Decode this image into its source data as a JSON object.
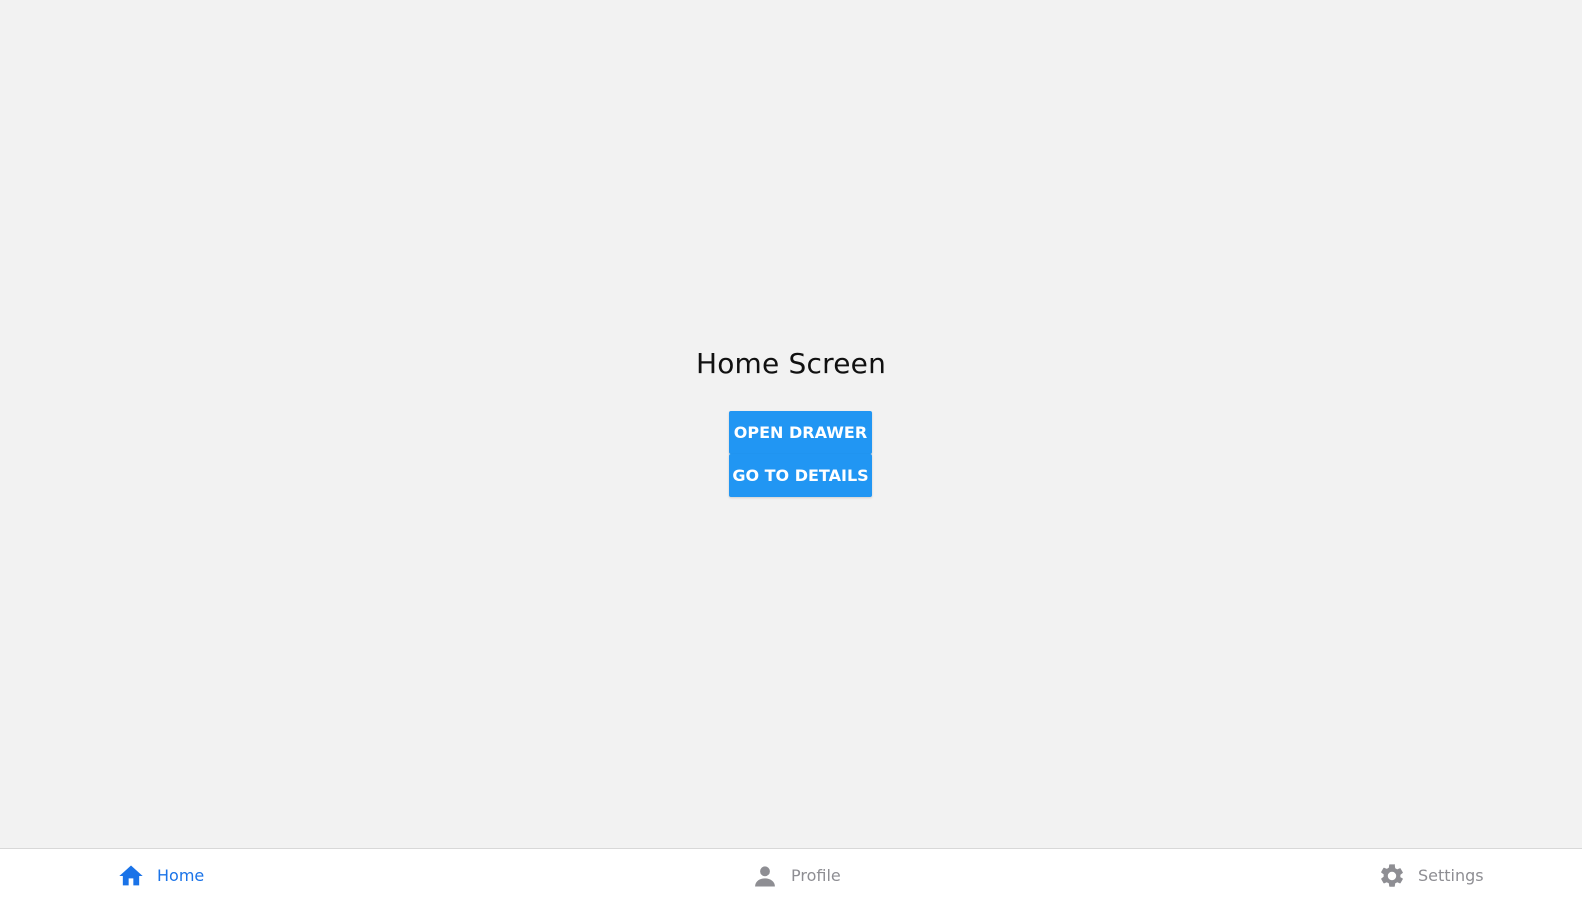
{
  "screen": {
    "title": "Home Screen",
    "buttons": {
      "open_drawer": "OPEN DRAWER",
      "go_to_details": "GO TO DETAILS"
    }
  },
  "tabbar": {
    "active_color": "#1a73e8",
    "inactive_color": "#8e8e93",
    "tabs": [
      {
        "label": "Home",
        "icon": "home-icon",
        "active": true
      },
      {
        "label": "Profile",
        "icon": "person-icon",
        "active": false
      },
      {
        "label": "Settings",
        "icon": "gear-icon",
        "active": false
      }
    ]
  },
  "colors": {
    "background": "#f2f2f2",
    "button": "#2196F3",
    "tabbar_background": "#ffffff"
  }
}
